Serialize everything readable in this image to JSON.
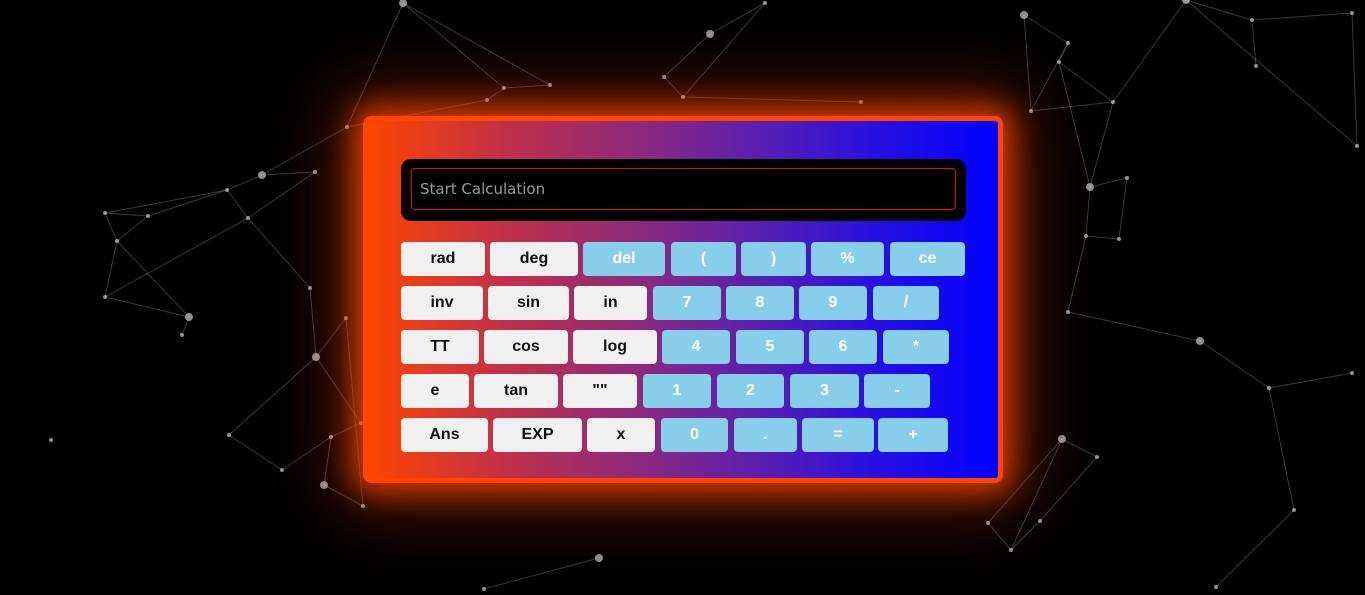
{
  "calculator": {
    "display": {
      "value": "",
      "placeholder": "Start Calculation"
    },
    "rows": [
      [
        {
          "label": "rad",
          "kind": "fn"
        },
        {
          "label": "deg",
          "kind": "fn"
        },
        {
          "label": "del",
          "kind": "num"
        },
        {
          "label": "(",
          "kind": "num"
        },
        {
          "label": ")",
          "kind": "num"
        },
        {
          "label": "%",
          "kind": "num"
        },
        {
          "label": "ce",
          "kind": "num"
        }
      ],
      [
        {
          "label": "inv",
          "kind": "fn"
        },
        {
          "label": "sin",
          "kind": "fn"
        },
        {
          "label": "in",
          "kind": "fn"
        },
        {
          "label": "7",
          "kind": "num"
        },
        {
          "label": "8",
          "kind": "num"
        },
        {
          "label": "9",
          "kind": "num"
        },
        {
          "label": "/",
          "kind": "num"
        }
      ],
      [
        {
          "label": "TT",
          "kind": "fn"
        },
        {
          "label": "cos",
          "kind": "fn"
        },
        {
          "label": "log",
          "kind": "fn"
        },
        {
          "label": "4",
          "kind": "num"
        },
        {
          "label": "5",
          "kind": "num"
        },
        {
          "label": "6",
          "kind": "num"
        },
        {
          "label": "*",
          "kind": "num"
        }
      ],
      [
        {
          "label": "e",
          "kind": "fn"
        },
        {
          "label": "tan",
          "kind": "fn"
        },
        {
          "label": "\"\"",
          "kind": "fn"
        },
        {
          "label": "1",
          "kind": "num"
        },
        {
          "label": "2",
          "kind": "num"
        },
        {
          "label": "3",
          "kind": "num"
        },
        {
          "label": "-",
          "kind": "num"
        }
      ],
      [
        {
          "label": "Ans",
          "kind": "fn"
        },
        {
          "label": "EXP",
          "kind": "fn"
        },
        {
          "label": "x",
          "kind": "fn"
        },
        {
          "label": "0",
          "kind": "num"
        },
        {
          "label": ".",
          "kind": "num"
        },
        {
          "label": "=",
          "kind": "num"
        },
        {
          "label": "+",
          "kind": "num"
        }
      ]
    ]
  },
  "colors": {
    "frame": "#ff4500",
    "gradient_end": "#0000ff",
    "function_key": "#f0f0f0",
    "number_key": "#87ceeb",
    "display_border": "#e01010"
  }
}
